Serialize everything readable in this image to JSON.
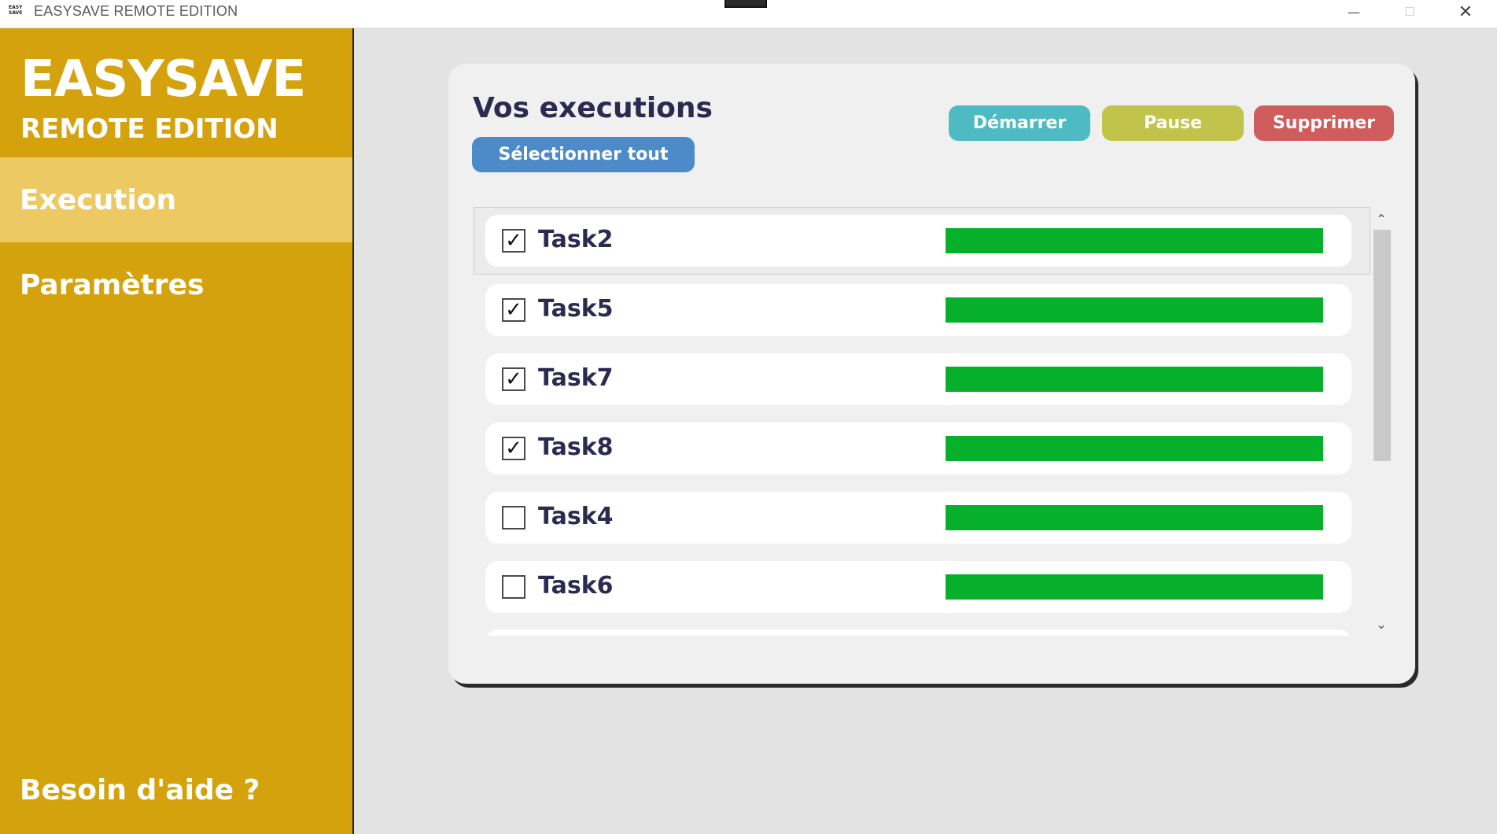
{
  "window": {
    "logo_line1": "EASY",
    "logo_line2": "SAVE",
    "title": "EASYSAVE REMOTE EDITION",
    "minimize_glyph": "—",
    "maximize_glyph": "☐",
    "close_glyph": "✕"
  },
  "sidebar": {
    "brand_title": "EASYSAVE",
    "brand_subtitle": "REMOTE EDITION",
    "items": [
      {
        "label": "Execution",
        "active": true
      },
      {
        "label": "Paramètres",
        "active": false
      }
    ],
    "help_label": "Besoin d'aide ?"
  },
  "main": {
    "title": "Vos executions",
    "select_all_label": "Sélectionner tout",
    "actions": {
      "start_label": "Démarrer",
      "pause_label": "Pause",
      "delete_label": "Supprimer"
    },
    "tasks": [
      {
        "name": "Task2",
        "checked": true,
        "progress": 1.0
      },
      {
        "name": "Task5",
        "checked": true,
        "progress": 1.0
      },
      {
        "name": "Task7",
        "checked": true,
        "progress": 1.0
      },
      {
        "name": "Task8",
        "checked": true,
        "progress": 1.0
      },
      {
        "name": "Task4",
        "checked": false,
        "progress": 1.0
      },
      {
        "name": "Task6",
        "checked": false,
        "progress": 1.0
      }
    ],
    "scroll": {
      "up_glyph": "⌃",
      "down_glyph": "⌄"
    }
  },
  "colors": {
    "sidebar_bg": "#d4a20c",
    "sidebar_active": "#edc964",
    "title_text": "#2c2a4f",
    "start_button": "#4ebbc3",
    "pause_button": "#c2c34a",
    "delete_button": "#d05d5d",
    "select_all_button": "#4c8bc8",
    "progress_fill": "#07b02b"
  }
}
